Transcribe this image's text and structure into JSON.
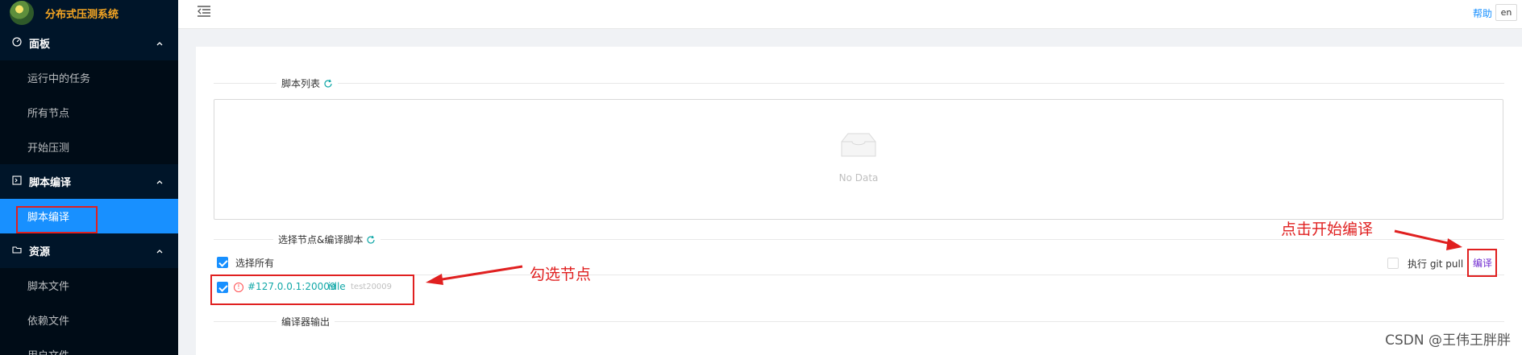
{
  "app": {
    "title": "分布式压测系统"
  },
  "sidebar": {
    "groups": [
      {
        "label": "面板",
        "icon": "dashboard-icon",
        "items": [
          "运行中的任务",
          "所有节点",
          "开始压测"
        ]
      },
      {
        "label": "脚本编译",
        "icon": "code-icon",
        "items": [
          "脚本编译"
        ]
      },
      {
        "label": "资源",
        "icon": "folder-icon",
        "items": [
          "脚本文件",
          "依赖文件",
          "用户文件"
        ]
      }
    ],
    "active_item": "脚本编译"
  },
  "header": {
    "help": "帮助",
    "lang": "en"
  },
  "script_list": {
    "title": "脚本列表",
    "empty_text": "No Data"
  },
  "node_select": {
    "title": "选择节点&编译脚本",
    "select_all_label": "选择所有",
    "git_pull_label": "执行 git pull",
    "compile_label": "编译",
    "node": {
      "addr": "#127.0.0.1:20009",
      "status": "idle",
      "tag": "test20009"
    }
  },
  "compiler_output": {
    "title": "编译器输出"
  },
  "annotations": {
    "compile_hint": "点击开始编译",
    "select_hint": "勾选节点"
  },
  "watermark": "CSDN @王伟王胖胖",
  "colors": {
    "sidebar_bg": "#001529",
    "active": "#1890ff",
    "annotation": "#e02020",
    "brand": "#f5a623"
  }
}
